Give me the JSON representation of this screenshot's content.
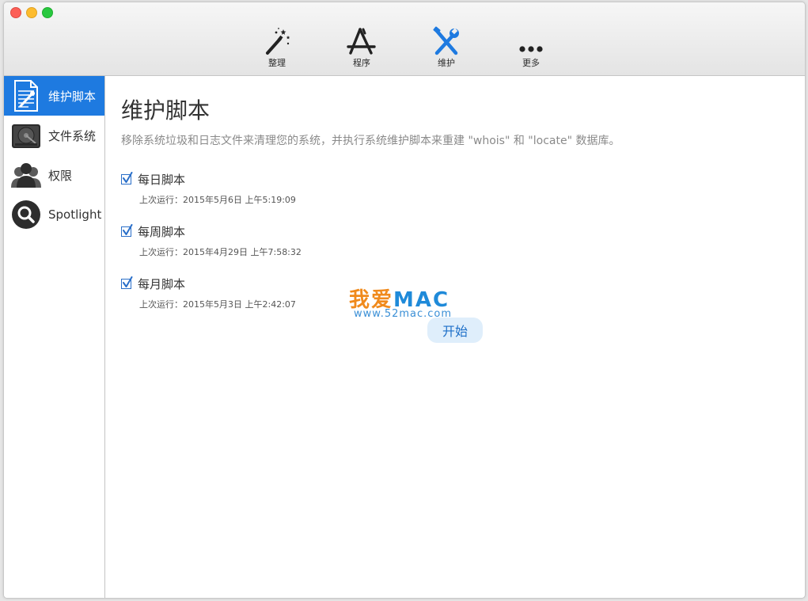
{
  "toolbar": {
    "items": [
      {
        "label": "整理",
        "icon": "magic-wand-icon"
      },
      {
        "label": "程序",
        "icon": "app-store-icon"
      },
      {
        "label": "维护",
        "icon": "wrench-screwdriver-icon",
        "active": true
      },
      {
        "label": "更多",
        "icon": "more-dots-icon"
      }
    ]
  },
  "sidebar": {
    "items": [
      {
        "label": "维护脚本",
        "icon": "script-document-icon",
        "active": true
      },
      {
        "label": "文件系统",
        "icon": "hard-drive-icon"
      },
      {
        "label": "权限",
        "icon": "users-icon"
      },
      {
        "label": "Spotlight",
        "icon": "spotlight-search-icon"
      }
    ]
  },
  "main": {
    "title": "维护脚本",
    "description": "移除系统垃圾和日志文件来清理您的系统，并执行系统维护脚本来重建 \"whois\" 和 \"locate\" 数据库。",
    "tasks": [
      {
        "name": "每日脚本",
        "checked": true,
        "last_run": "上次运行：2015年5月6日 上午5:19:09"
      },
      {
        "name": "每周脚本",
        "checked": true,
        "last_run": "上次运行：2015年4月29日 上午7:58:32"
      },
      {
        "name": "每月脚本",
        "checked": true,
        "last_run": "上次运行：2015年5月3日 上午2:42:07"
      }
    ],
    "start_label": "开始"
  },
  "watermark": {
    "brand_cn": "我爱",
    "brand_mac": "MAC",
    "url": "www.52mac.com"
  },
  "colors": {
    "accent": "#1e7ae0",
    "checkbox": "#2a6fc9",
    "watermark_orange": "#f08a1c",
    "watermark_blue": "#1f8ad9"
  }
}
